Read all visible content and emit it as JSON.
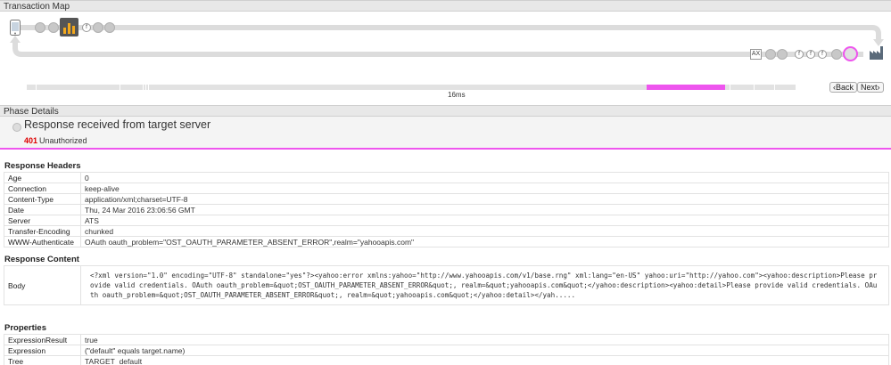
{
  "transaction_map": {
    "title": "Transaction Map",
    "ax_label": "AX",
    "node_letters": [
      "f",
      "f",
      "f",
      "f"
    ],
    "timeline_label": "16ms",
    "back_label": "Back",
    "next_label": "Next"
  },
  "phase": {
    "header": "Phase Details",
    "title": "Response received from target server",
    "status_code": "401",
    "status_text": "Unauthorized"
  },
  "response_headers": {
    "title": "Response Headers",
    "rows": [
      {
        "k": "Age",
        "v": "0"
      },
      {
        "k": "Connection",
        "v": "keep-alive"
      },
      {
        "k": "Content-Type",
        "v": "application/xml;charset=UTF-8"
      },
      {
        "k": "Date",
        "v": "Thu, 24 Mar 2016 23:06:56 GMT"
      },
      {
        "k": "Server",
        "v": "ATS"
      },
      {
        "k": "Transfer-Encoding",
        "v": "chunked"
      },
      {
        "k": "WWW-Authenticate",
        "v": "OAuth oauth_problem=\"OST_OAUTH_PARAMETER_ABSENT_ERROR\",realm=\"yahooapis.com\""
      }
    ]
  },
  "response_content": {
    "title": "Response Content",
    "key": "Body",
    "value": "<?xml version=\"1.0\" encoding=\"UTF-8\" standalone=\"yes\"?><yahoo:error xmlns:yahoo=\"http://www.yahooapis.com/v1/base.rng\" xml:lang=\"en-US\" yahoo:uri=\"http://yahoo.com\"><yahoo:description>Please provide valid credentials. OAuth oauth_problem=&quot;OST_OAUTH_PARAMETER_ABSENT_ERROR&quot;, realm=&quot;yahooapis.com&quot;</yahoo:description><yahoo:detail>Please provide valid credentials. OAuth oauth_problem=&quot;OST_OAUTH_PARAMETER_ABSENT_ERROR&quot;, realm=&quot;yahooapis.com&quot;</yahoo:detail></yah....."
  },
  "properties": {
    "title": "Properties",
    "rows": [
      {
        "k": "ExpressionResult",
        "v": "true"
      },
      {
        "k": "Expression",
        "v": "(\"default\" equals target.name)"
      },
      {
        "k": "Tree",
        "v": "TARGET_default"
      }
    ]
  },
  "colors": {
    "accent": "#ee55ee",
    "error": "#dd0000"
  }
}
